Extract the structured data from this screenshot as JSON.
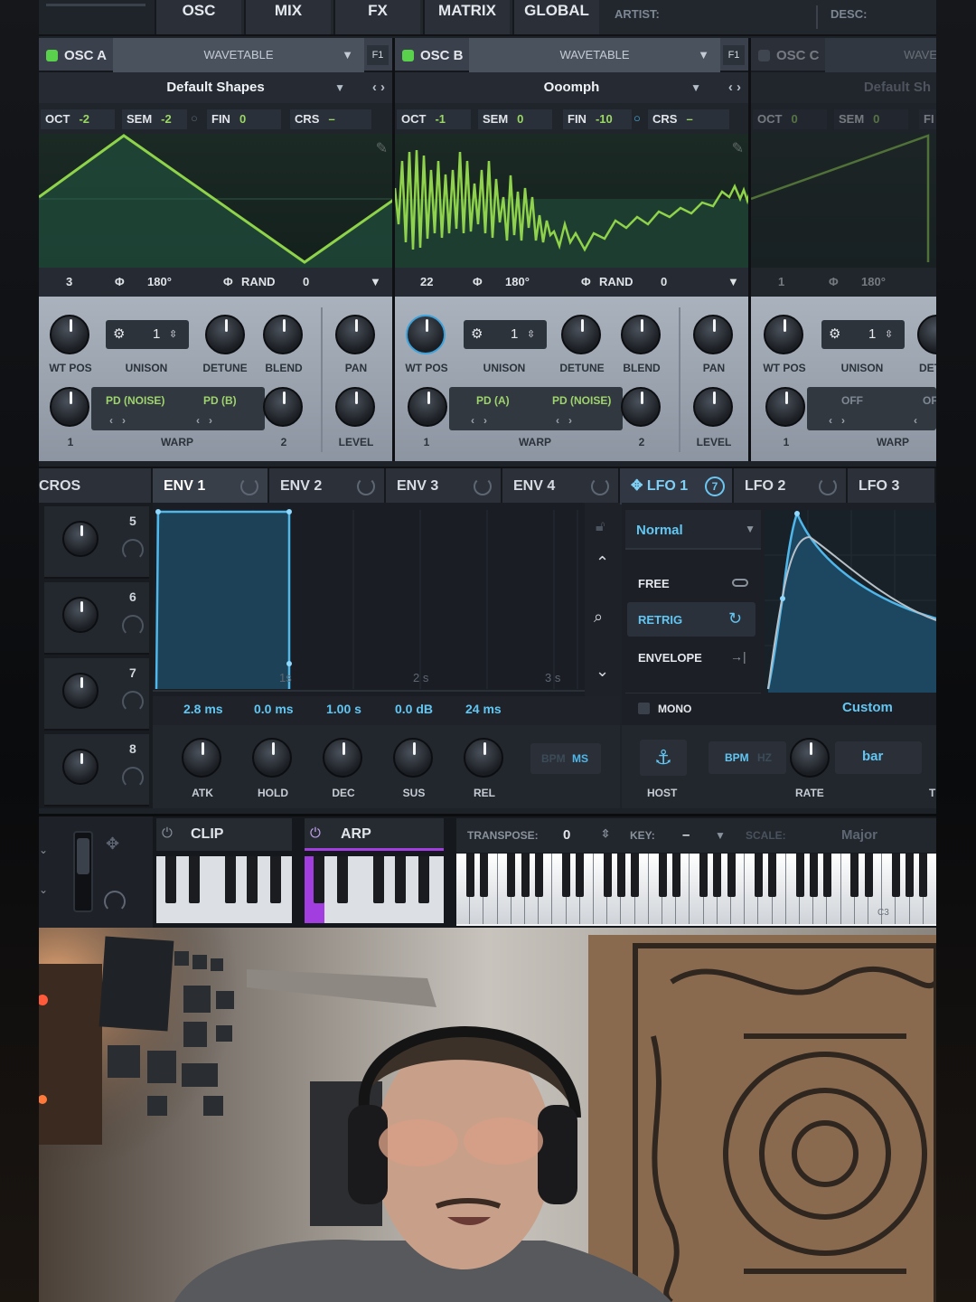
{
  "top_nav": {
    "tabs": [
      "OSC",
      "MIX",
      "FX",
      "MATRIX",
      "GLOBAL"
    ],
    "artist_label": "ARTIST:",
    "desc_label": "DESC:"
  },
  "oscillators": [
    {
      "name": "OSC A",
      "type": "WAVETABLE",
      "filter_route": "F1",
      "wavetable": "Default Shapes",
      "oct_label": "OCT",
      "oct": "-2",
      "sem_label": "SEM",
      "sem": "-2",
      "fin_label": "FIN",
      "fin": "0",
      "crs_label": "CRS",
      "crs": "–",
      "frame": "3",
      "phase": "180°",
      "rand_label": "RAND",
      "rand": "0",
      "unison": "1",
      "warp1": "PD (NOISE)",
      "warp2": "PD (B)"
    },
    {
      "name": "OSC B",
      "type": "WAVETABLE",
      "filter_route": "F1",
      "wavetable": "Ooomph",
      "oct_label": "OCT",
      "oct": "-1",
      "sem_label": "SEM",
      "sem": "0",
      "fin_label": "FIN",
      "fin": "-10",
      "crs_label": "CRS",
      "crs": "–",
      "frame": "22",
      "phase": "180°",
      "rand_label": "RAND",
      "rand": "0",
      "unison": "1",
      "warp1": "PD (A)",
      "warp2": "PD (NOISE)"
    },
    {
      "name": "OSC C",
      "type": "WAVE",
      "wavetable": "Default Sh",
      "oct_label": "OCT",
      "oct": "0",
      "sem_label": "SEM",
      "sem": "0",
      "fin_label": "FI",
      "frame": "1",
      "phase": "180°",
      "unison": "1",
      "warp1": "OFF",
      "warp2": "OF"
    }
  ],
  "osc_knob_labels": {
    "wt_pos": "WT POS",
    "unison": "UNISON",
    "detune": "DETUNE",
    "blend": "BLEND",
    "pan": "PAN",
    "level": "LEVEL",
    "warp": "WARP",
    "warp_1": "1",
    "warp_2": "2",
    "detune_short": "DET"
  },
  "mod_tabs": {
    "macros": "CROS",
    "env1": "ENV 1",
    "env2": "ENV 2",
    "env3": "ENV 3",
    "env4": "ENV 4",
    "lfo1": "LFO 1",
    "lfo1_count": "7",
    "lfo2": "LFO 2",
    "lfo3": "LFO 3"
  },
  "macros": [
    "5",
    "6",
    "7",
    "8"
  ],
  "envelope": {
    "time_marks": [
      "1s",
      "2 s",
      "3 s"
    ],
    "attack": "2.8 ms",
    "hold": "0.0 ms",
    "decay": "1.00 s",
    "sustain": "0.0 dB",
    "release": "24 ms",
    "labels": {
      "atk": "ATK",
      "hold": "HOLD",
      "dec": "DEC",
      "sus": "SUS",
      "rel": "REL"
    },
    "bpm": "BPM",
    "ms": "MS"
  },
  "lfo": {
    "mode": "Normal",
    "trig_modes": [
      "FREE",
      "RETRIG",
      "ENVELOPE"
    ],
    "selected_trig": "RETRIG",
    "mono": "MONO",
    "shape": "Custom",
    "host": "HOST",
    "bpm": "BPM",
    "hz": "HZ",
    "rate_value": "bar",
    "rate": "RATE",
    "trig_short": "T"
  },
  "bottom": {
    "clip": "CLIP",
    "arp": "ARP",
    "transpose_label": "TRANSPOSE:",
    "transpose": "0",
    "key_label": "KEY:",
    "key": "–",
    "scale_label": "SCALE:",
    "scale": "Major",
    "octave_mark": "C3"
  },
  "colors": {
    "accent_green": "#8fd34a",
    "accent_blue": "#4fb7ea",
    "arp_purple": "#a23ee0",
    "panel": "#1d2128"
  }
}
